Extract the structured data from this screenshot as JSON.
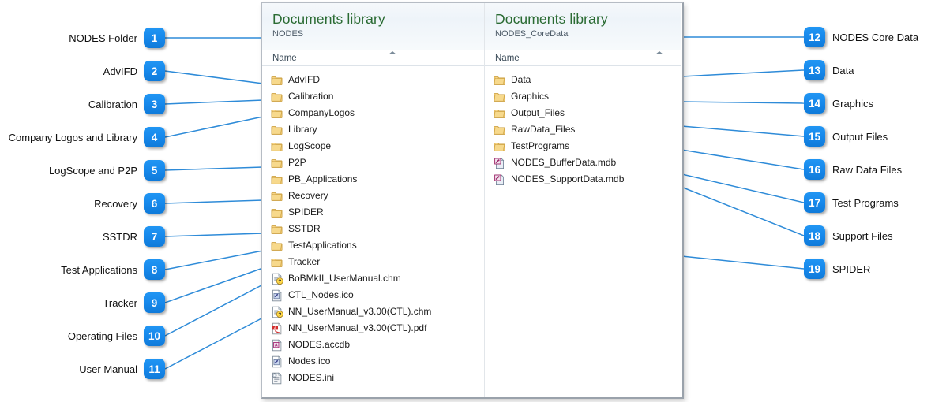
{
  "window": {
    "panes": [
      {
        "title": "Documents library",
        "subtitle": "NODES",
        "column_header": "Name",
        "items": [
          {
            "name": "AdvIFD",
            "icon": "folder-icon"
          },
          {
            "name": "Calibration",
            "icon": "folder-icon"
          },
          {
            "name": "CompanyLogos",
            "icon": "folder-icon"
          },
          {
            "name": "Library",
            "icon": "folder-icon"
          },
          {
            "name": "LogScope",
            "icon": "folder-icon"
          },
          {
            "name": "P2P",
            "icon": "folder-icon"
          },
          {
            "name": "PB_Applications",
            "icon": "folder-icon"
          },
          {
            "name": "Recovery",
            "icon": "folder-icon"
          },
          {
            "name": "SPIDER",
            "icon": "folder-icon"
          },
          {
            "name": "SSTDR",
            "icon": "folder-icon"
          },
          {
            "name": "TestApplications",
            "icon": "folder-icon"
          },
          {
            "name": "Tracker",
            "icon": "folder-icon"
          },
          {
            "name": "BoBMkII_UserManual.chm",
            "icon": "chm-help-icon"
          },
          {
            "name": "CTL_Nodes.ico",
            "icon": "ico-file-icon"
          },
          {
            "name": "NN_UserManual_v3.00(CTL).chm",
            "icon": "chm-help-icon"
          },
          {
            "name": "NN_UserManual_v3.00(CTL).pdf",
            "icon": "pdf-file-icon"
          },
          {
            "name": "NODES.accdb",
            "icon": "access-db-icon"
          },
          {
            "name": "Nodes.ico",
            "icon": "ico-file-icon"
          },
          {
            "name": "NODES.ini",
            "icon": "ini-config-icon"
          }
        ]
      },
      {
        "title": "Documents library",
        "subtitle": "NODES_CoreData",
        "column_header": "Name",
        "items": [
          {
            "name": "Data",
            "icon": "folder-icon"
          },
          {
            "name": "Graphics",
            "icon": "folder-icon"
          },
          {
            "name": "Output_Files",
            "icon": "folder-icon"
          },
          {
            "name": "RawData_Files",
            "icon": "folder-icon"
          },
          {
            "name": "TestPrograms",
            "icon": "folder-icon"
          },
          {
            "name": "NODES_BufferData.mdb",
            "icon": "mdb-file-icon"
          },
          {
            "name": "NODES_SupportData.mdb",
            "icon": "mdb-file-icon"
          }
        ]
      }
    ]
  },
  "callouts": {
    "left": [
      {
        "num": "1",
        "label": "NODES Folder"
      },
      {
        "num": "2",
        "label": "AdvIFD"
      },
      {
        "num": "3",
        "label": "Calibration"
      },
      {
        "num": "4",
        "label": "Company Logos and Library"
      },
      {
        "num": "5",
        "label": "LogScope and P2P"
      },
      {
        "num": "6",
        "label": "Recovery"
      },
      {
        "num": "7",
        "label": "SSTDR"
      },
      {
        "num": "8",
        "label": "Test Applications"
      },
      {
        "num": "9",
        "label": "Tracker"
      },
      {
        "num": "10",
        "label": "Operating Files"
      },
      {
        "num": "11",
        "label": "User Manual"
      }
    ],
    "right": [
      {
        "num": "12",
        "label": "NODES Core Data"
      },
      {
        "num": "13",
        "label": "Data"
      },
      {
        "num": "14",
        "label": "Graphics"
      },
      {
        "num": "15",
        "label": "Output Files"
      },
      {
        "num": "16",
        "label": "Raw Data Files"
      },
      {
        "num": "17",
        "label": "Test Programs"
      },
      {
        "num": "18",
        "label": "Support Files"
      },
      {
        "num": "19",
        "label": "SPIDER"
      }
    ]
  },
  "colors": {
    "badge_blue": "#1789ec",
    "connector_blue": "#2e8bd8",
    "library_title_green": "#2a6b33",
    "folder_yellow": "#f5d17a"
  }
}
